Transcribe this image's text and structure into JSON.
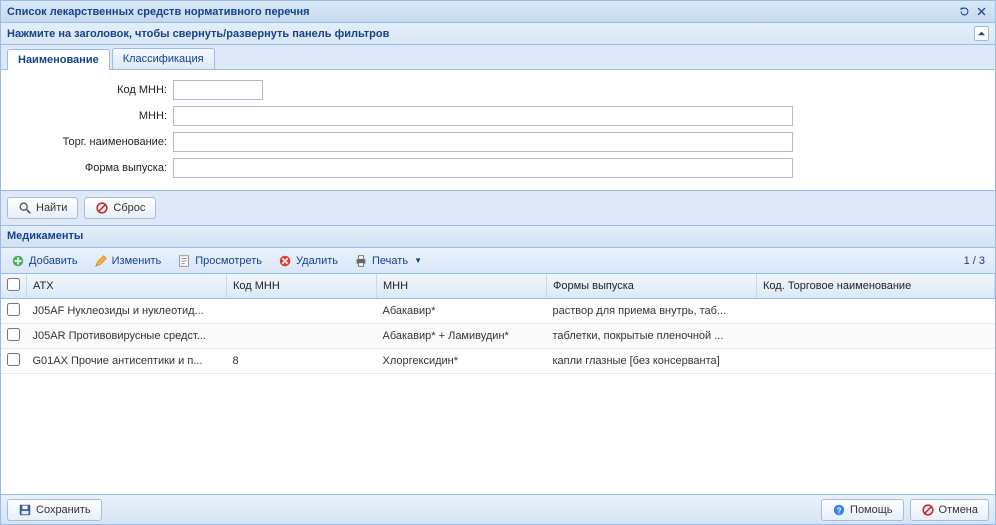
{
  "window": {
    "title": "Список лекарственных средств нормативного перечня"
  },
  "filter_header": {
    "title": "Нажмите на заголовок, чтобы свернуть/развернуть панель фильтров"
  },
  "tabs": {
    "naming": "Наименование",
    "classification": "Классификация"
  },
  "form": {
    "code_mnn_label": "Код МНН:",
    "mnn_label": "МНН:",
    "trade_name_label": "Торг. наименование:",
    "release_form_label": "Форма выпуска:",
    "code_mnn_value": "",
    "mnn_value": "",
    "trade_name_value": "",
    "release_form_value": ""
  },
  "buttons": {
    "find": "Найти",
    "reset": "Сброс"
  },
  "grid_title": "Медикаменты",
  "toolbar": {
    "add": "Добавить",
    "edit": "Изменить",
    "view": "Просмотреть",
    "delete": "Удалить",
    "print": "Печать"
  },
  "pager": {
    "text": "1 / 3"
  },
  "columns": {
    "atx": "АТХ",
    "code_mnn": "Код МНН",
    "mnn": "МНН",
    "release_form": "Формы выпуска",
    "trade_code": "Код. Торговое наименование"
  },
  "rows": [
    {
      "atx": "J05AF Нуклеозиды и нуклеотид...",
      "code_mnn": "",
      "mnn": "Абакавир*",
      "release_form": "раствор для приема внутрь, таб...",
      "trade_code": ""
    },
    {
      "atx": "J05AR Противовирусные средст...",
      "code_mnn": "",
      "mnn": "Абакавир* + Ламивудин*",
      "release_form": "таблетки, покрытые пленочной ...",
      "trade_code": ""
    },
    {
      "atx": "G01AX Прочие антисептики и п...",
      "code_mnn": "8",
      "mnn": "Хлоргексидин*",
      "release_form": "капли глазные [без консерванта]",
      "trade_code": ""
    }
  ],
  "footer": {
    "save": "Сохранить",
    "help": "Помощь",
    "cancel": "Отмена"
  }
}
